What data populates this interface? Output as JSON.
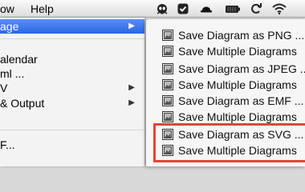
{
  "menubar": {
    "menus": [
      "ow",
      "Help"
    ]
  },
  "tray_icons": [
    "alien-icon",
    "checkmark-icon",
    "hat-icon",
    "battery-icon",
    "sync-icon",
    "wifi-icon"
  ],
  "left_menu": {
    "items": [
      {
        "label": "age",
        "has_submenu": true,
        "active": true
      },
      {
        "label": "alendar",
        "has_submenu": false
      },
      {
        "label": "ml ...",
        "has_submenu": false
      },
      {
        "label": "V",
        "has_submenu": true
      },
      {
        "label": "& Output",
        "has_submenu": true
      },
      {
        "label": "F...",
        "has_submenu": false
      }
    ]
  },
  "submenu": {
    "items": [
      {
        "label": "Save Diagram as PNG ..."
      },
      {
        "label": "Save Multiple Diagrams"
      },
      {
        "label": "Save Diagram as JPEG ..."
      },
      {
        "label": "Save Multiple Diagrams"
      },
      {
        "label": "Save Diagram as EMF ..."
      },
      {
        "label": "Save Multiple Diagrams"
      },
      {
        "label": "Save Diagram as SVG ..."
      },
      {
        "label": "Save Multiple Diagrams"
      }
    ]
  },
  "colors": {
    "menu_highlight": "#2f6fe8",
    "callout_border": "#e0453a"
  }
}
